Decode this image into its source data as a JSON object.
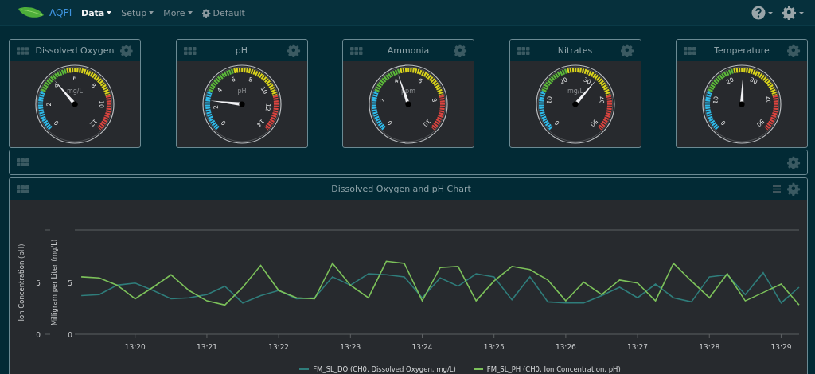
{
  "navbar": {
    "brand": "AQPI",
    "menu": [
      {
        "label": "Data",
        "selected": true,
        "kind": "dropdown"
      },
      {
        "label": "Setup",
        "selected": false,
        "kind": "dropdown"
      },
      {
        "label": "More",
        "selected": false,
        "kind": "dropdown"
      },
      {
        "label": "Default",
        "selected": false,
        "kind": "settings"
      }
    ]
  },
  "gauges": [
    {
      "title": "Dissolved Oxygen",
      "unit": "mg/L",
      "ticks": [
        "0",
        "2",
        "4",
        "6",
        "8",
        "10",
        "12"
      ],
      "level": 0.35
    },
    {
      "title": "pH",
      "unit": "pH",
      "ticks": [
        "0",
        "2",
        "4",
        "6",
        "8",
        "10",
        "12",
        "14"
      ],
      "level": 0.19
    },
    {
      "title": "Ammonia",
      "unit": "ppm",
      "ticks": [
        "0",
        "2",
        "4",
        "6",
        "8",
        "10"
      ],
      "level": 0.43
    },
    {
      "title": "Nitrates",
      "unit": "mg/L",
      "ticks": [
        "0",
        "10",
        "20",
        "30",
        "40",
        "50"
      ],
      "level": 0.65
    },
    {
      "title": "Temperature",
      "ticks": [
        "0",
        "10",
        "20",
        "30",
        "40",
        "50"
      ],
      "level": 0.51
    }
  ],
  "chart_panel": {
    "title": "Dissolved Oxygen and pH Chart",
    "secondary_axis": {
      "label": "Ion Concentration (pH)",
      "ticks": [
        "5",
        "0"
      ]
    },
    "chart_data": {
      "type": "line",
      "ylabel": "Milligram per Liter (mg/L)",
      "categories": [
        null,
        null,
        null,
        "13:20",
        null,
        null,
        null,
        "13:21",
        null,
        null,
        null,
        "13:22",
        null,
        null,
        null,
        "13:23",
        null,
        null,
        null,
        "13:24",
        null,
        null,
        null,
        "13:25",
        null,
        null,
        null,
        "13:26",
        null,
        null,
        null,
        "13:27",
        null,
        null,
        null,
        "13:28",
        null,
        null,
        null,
        "13:29",
        null
      ],
      "series": [
        {
          "name": "FM_SL_DO (CH0, Dissolved Oxygen, mg/L)",
          "color": "#2f7d7b",
          "values": [
            3.7,
            3.8,
            4.7,
            4.9,
            4.2,
            3.4,
            3.5,
            3.8,
            4.6,
            3.0,
            3.7,
            4.2,
            3.4,
            3.5,
            5.5,
            4.7,
            5.8,
            5.7,
            5.5,
            3.5,
            5.4,
            4.6,
            5.8,
            5.5,
            3.3,
            5.5,
            3.1,
            3.0,
            3.0,
            3.7,
            4.5,
            3.5,
            4.8,
            3.5,
            3.1,
            5.5,
            5.7,
            3.8,
            5.9,
            3.0,
            4.5
          ]
        },
        {
          "name": "FM_SL_PH (CH0, Ion Concentration, pH)",
          "color": "#7cc15a",
          "values": [
            5.5,
            5.4,
            4.7,
            3.4,
            4.5,
            5.7,
            4.2,
            3.2,
            2.8,
            4.5,
            6.6,
            4.2,
            3.5,
            3.4,
            6.8,
            4.7,
            3.5,
            7.0,
            6.8,
            3.2,
            6.4,
            6.5,
            3.2,
            5.1,
            6.5,
            6.2,
            5.2,
            3.2,
            5.0,
            3.8,
            5.2,
            4.9,
            3.2,
            6.8,
            5.1,
            3.5,
            5.8,
            3.2,
            4.0,
            4.8,
            2.8
          ]
        }
      ],
      "ylim": [
        0,
        10
      ],
      "yticks": [
        0,
        5
      ]
    }
  }
}
